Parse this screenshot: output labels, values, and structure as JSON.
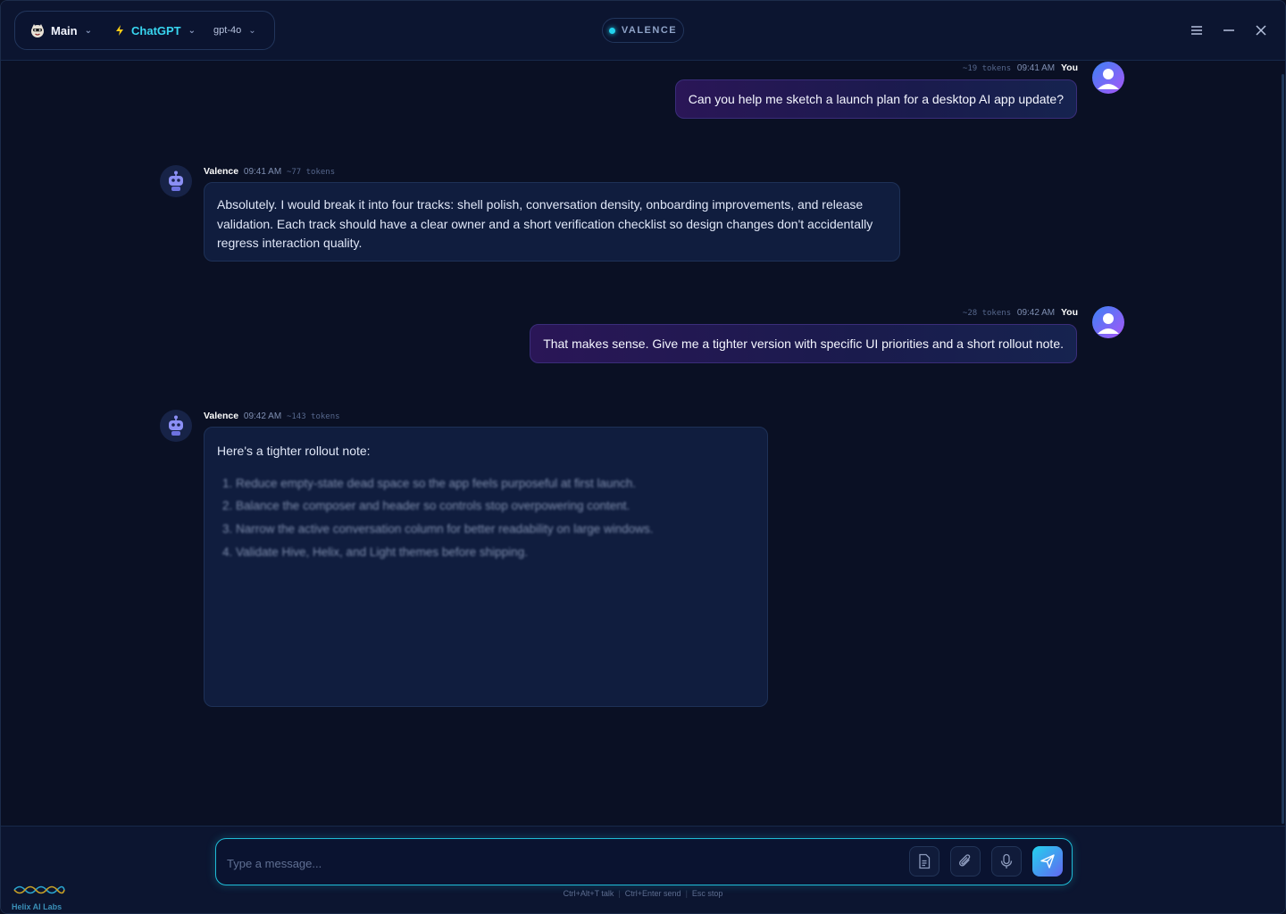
{
  "header": {
    "workspace": "Main",
    "provider": "ChatGPT",
    "model": "gpt-4o",
    "brand": "VALENCE"
  },
  "messages": [
    {
      "role": "user",
      "tokens": "~19 tokens",
      "time": "09:41 AM",
      "author": "You",
      "text": "Can you help me sketch a launch plan for a desktop AI app update?"
    },
    {
      "role": "assistant",
      "author": "Valence",
      "time": "09:41 AM",
      "tokens": "~77 tokens",
      "text": "Absolutely. I would break it into four tracks: shell polish, conversation density, onboarding improvements, and release validation. Each track should have a clear owner and a short verification checklist so design changes don't accidentally regress interaction quality."
    },
    {
      "role": "user",
      "tokens": "~28 tokens",
      "time": "09:42 AM",
      "author": "You",
      "text": "That makes sense. Give me a tighter version with specific UI priorities and a short rollout note."
    },
    {
      "role": "assistant",
      "author": "Valence",
      "time": "09:42 AM",
      "tokens": "~143 tokens",
      "intro": "Here's a tighter rollout note:",
      "items": [
        "1. Reduce empty-state dead space so the app feels purposeful at first launch.",
        "2. Balance the composer and header so controls stop overpowering content.",
        "3. Narrow the active conversation column for better readability on large windows.",
        "4. Validate Hive, Helix, and Light themes before shipping."
      ]
    }
  ],
  "composer": {
    "placeholder": "Type a message..."
  },
  "shortcuts": [
    "Ctrl+Alt+T talk",
    "Ctrl+Enter send",
    "Esc stop"
  ],
  "footer": {
    "lab_name": "Helix AI Labs"
  },
  "colors": {
    "accent": "#22d3ee",
    "user_bubble": "#2a1657",
    "bot_bubble": "#101d3e",
    "background": "#0a1024"
  },
  "icons": [
    "mascot-icon",
    "bolt-icon",
    "menu-icon",
    "minimize-icon",
    "close-icon",
    "robot-icon",
    "user-icon",
    "document-icon",
    "paperclip-icon",
    "microphone-icon",
    "send-icon",
    "helix-logo-icon"
  ]
}
